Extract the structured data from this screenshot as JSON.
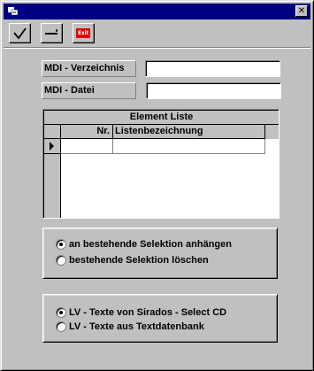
{
  "toolbar": {
    "exit_label": "Exit"
  },
  "fields": {
    "verzeichnis_label": "MDI - Verzeichnis",
    "verzeichnis_value": "",
    "datei_label": "MDI - Datei",
    "datei_value": ""
  },
  "grid": {
    "caption": "Element Liste",
    "columns": [
      "Nr.",
      "Listenbezeichnung"
    ],
    "rows": [
      [
        "",
        ""
      ]
    ]
  },
  "selection_group": {
    "options": [
      "an bestehende Selektion anhängen",
      "bestehende Selektion löschen"
    ],
    "selected": 0
  },
  "source_group": {
    "options": [
      "LV - Texte von Sirados - Select CD",
      "LV - Texte aus Textdatenbank"
    ],
    "selected": 0
  },
  "icons": {
    "app": "app-icon",
    "close": "close-icon",
    "ok": "checkmark-icon",
    "minus": "minus-icon",
    "exit": "exit-icon",
    "row_indicator": "triangle-right-icon"
  }
}
